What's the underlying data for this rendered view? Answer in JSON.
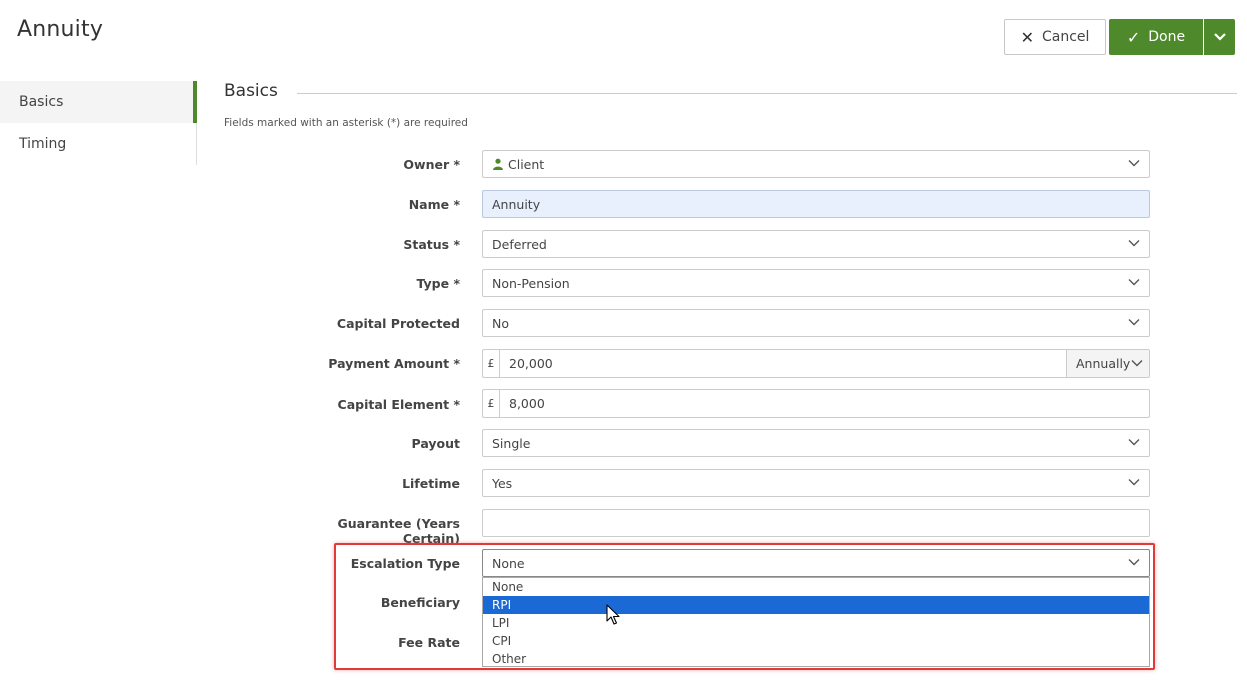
{
  "page": {
    "title": "Annuity"
  },
  "toolbar": {
    "cancel_label": "Cancel",
    "done_label": "Done"
  },
  "sidebar": {
    "items": [
      {
        "label": "Basics",
        "active": true
      },
      {
        "label": "Timing",
        "active": false
      }
    ]
  },
  "section": {
    "title": "Basics",
    "required_note": "Fields marked with an asterisk (*) are required"
  },
  "form": {
    "owner": {
      "label": "Owner *",
      "value": "Client"
    },
    "name": {
      "label": "Name *",
      "value": "Annuity"
    },
    "status": {
      "label": "Status *",
      "value": "Deferred"
    },
    "type": {
      "label": "Type *",
      "value": "Non-Pension"
    },
    "capital_protected": {
      "label": "Capital Protected",
      "value": "No"
    },
    "payment_amount": {
      "label": "Payment Amount *",
      "currency": "£",
      "value": "20,000",
      "frequency": "Annually"
    },
    "capital_element": {
      "label": "Capital Element *",
      "currency": "£",
      "value": "8,000"
    },
    "payout": {
      "label": "Payout",
      "value": "Single"
    },
    "lifetime": {
      "label": "Lifetime",
      "value": "Yes"
    },
    "guarantee": {
      "label": "Guarantee (Years Certain)",
      "value": ""
    },
    "escalation_type": {
      "label": "Escalation Type",
      "value": "None",
      "options": [
        "None",
        "RPI",
        "LPI",
        "CPI",
        "Other"
      ],
      "highlighted": "RPI"
    },
    "beneficiary": {
      "label": "Beneficiary"
    },
    "fee_rate": {
      "label": "Fee Rate"
    }
  },
  "colors": {
    "accent": "#4e8a2b",
    "selection": "#1a69d4",
    "annotation": "#e03a3a"
  }
}
